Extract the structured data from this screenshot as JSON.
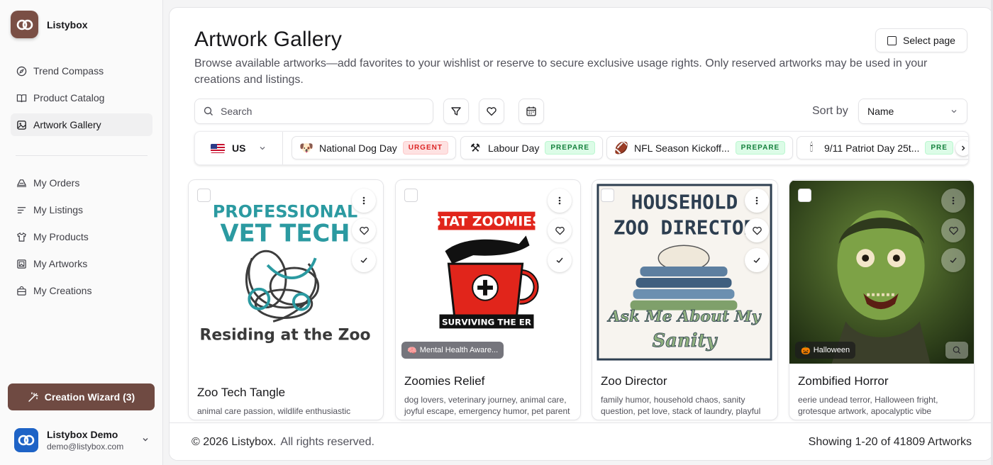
{
  "app": {
    "name": "Listybox"
  },
  "sidebar": {
    "nav_primary": [
      {
        "label": "Trend Compass",
        "icon": "compass-icon"
      },
      {
        "label": "Product Catalog",
        "icon": "book-icon"
      },
      {
        "label": "Artwork Gallery",
        "icon": "image-icon",
        "active": true
      }
    ],
    "nav_secondary": [
      {
        "label": "My Orders",
        "icon": "truck-icon"
      },
      {
        "label": "My Listings",
        "icon": "list-icon"
      },
      {
        "label": "My Products",
        "icon": "shirt-icon"
      },
      {
        "label": "My Artworks",
        "icon": "gallery-icon"
      },
      {
        "label": "My Creations",
        "icon": "bag-icon"
      }
    ],
    "wizard_label": "Creation Wizard (3)",
    "user": {
      "name": "Listybox Demo",
      "email": "demo@listybox.com"
    }
  },
  "header": {
    "title": "Artwork Gallery",
    "description": "Browse available artworks—add favorites to your wishlist or reserve to secure exclusive usage rights. Only reserved artworks may be used in your creations and listings.",
    "select_page_label": "Select page"
  },
  "toolbar": {
    "search_placeholder": "Search",
    "sort_label": "Sort by",
    "sort_value": "Name"
  },
  "events": {
    "country": "US",
    "items": [
      {
        "emoji": "🐶",
        "label": "National Dog Day",
        "badge": "URGENT",
        "kind": "urgent"
      },
      {
        "emoji": "⚒",
        "label": "Labour Day",
        "badge": "PREPARE",
        "kind": "prepare"
      },
      {
        "emoji": "🏈",
        "label": "NFL Season Kickoff...",
        "badge": "PREPARE",
        "kind": "prepare"
      },
      {
        "emoji": "🕯",
        "label": "9/11 Patriot Day 25t...",
        "badge": "PRE",
        "kind": "prepare"
      }
    ]
  },
  "cards": [
    {
      "title": "Zoo Tech Tangle",
      "tags": "animal care passion, wildlife enthusiastic",
      "art": {
        "line1": "PROFESSIONAL",
        "line2": "VET TECH",
        "line3": "Residing at the Zoo"
      }
    },
    {
      "title": "Zoomies Relief",
      "tags": "dog lovers, veterinary journey, animal care, joyful escape, emergency humor, pet parent",
      "badge": "Mental Health Aware...",
      "badge_emoji": "🧠",
      "art": {
        "line1": "STAT ZOOMIES",
        "line2": "SURVIVING THE ER"
      }
    },
    {
      "title": "Zoo Director",
      "tags": "family humor, household chaos, sanity question, pet love, stack of laundry, playful",
      "art": {
        "line1": "HOUSEHOLD",
        "line2": "ZOO DIRECTOR",
        "line3": "Ask Me About My",
        "line4": "Sanity"
      }
    },
    {
      "title": "Zombified Horror",
      "tags": "eerie undead terror, Halloween fright, grotesque artwork, apocalyptic vibe",
      "badge": "Halloween",
      "badge_emoji": "🎃"
    }
  ],
  "footer": {
    "copyright": "© 2026 Listybox.",
    "rights": "All rights reserved.",
    "count": "Showing 1-20 of 41809 Artworks"
  }
}
